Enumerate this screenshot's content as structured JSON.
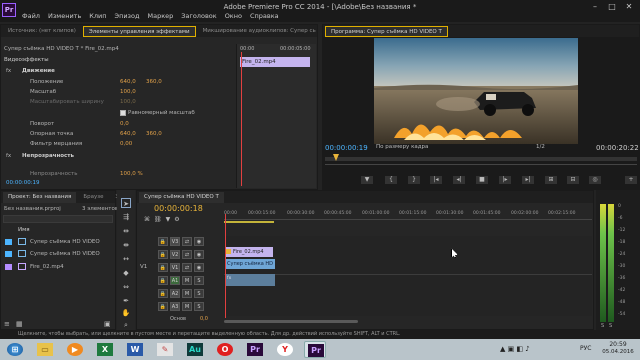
{
  "window": {
    "title": "Adobe Premiere Pro CC 2014 - [\\Adobe\\Без названия *",
    "menu": [
      "Файл",
      "Изменить",
      "Клип",
      "Эпизод",
      "Маркер",
      "Заголовок",
      "Окно",
      "Справка"
    ]
  },
  "effects_panel": {
    "tabs": [
      "Источник: (нет клипов)",
      "Элементы управления эффектами",
      "Микширование аудиоклипов: Супер сь"
    ],
    "breadcrumb": "Супер съёмка HD VIDEO T * Fire_02.mp4",
    "section_video": "Видеоэффекты",
    "motion_label": "Движение",
    "rows": [
      {
        "label": "Положение",
        "v1": "640,0",
        "v2": "360,0"
      },
      {
        "label": "Масштаб",
        "v1": "100,0",
        "v2": ""
      },
      {
        "label": "Масштабировать ширину",
        "v1": "100,0",
        "v2": ""
      },
      {
        "label": "Поворот",
        "v1": "0,0",
        "v2": ""
      },
      {
        "label": "Опорная точка",
        "v1": "640,0",
        "v2": "360,0"
      },
      {
        "label": "Фильтр мерцания",
        "v1": "0,00",
        "v2": ""
      }
    ],
    "uniform_scale": "Равномерный масштаб",
    "opacity_label": "Непрозрачность",
    "opacity_sub": "Непрозрачность",
    "opacity_value": "100,0 %",
    "clip_name": "Fire_02.mp4",
    "timecode": "00:00:00:19",
    "ruler_left": "00:00",
    "ruler_right": "00:00:05:00"
  },
  "program": {
    "tab": "Программа: Супер съёмка HD VIDEO T",
    "timecode_left": "00:00:00:19",
    "fit_label": "По размеру кадра",
    "ratio": "1/2",
    "timecode_right": "00:00:20:22"
  },
  "project": {
    "tabs": [
      "Проект: Без названия",
      "Браузе",
      "Эфф"
    ],
    "file": "Без названия.prproj",
    "count": "3 элементов",
    "column_name": "Имя",
    "items": [
      {
        "name": "Супер съёмка HD VIDEO",
        "color": "#4db5ff"
      },
      {
        "name": "Супер съёмка HD VIDEO",
        "color": "#4db5ff"
      },
      {
        "name": "Fire_02.mp4",
        "color": "#b48cff"
      }
    ]
  },
  "timeline": {
    "tab": "Супер съёмка HD VIDEO T",
    "timecode": "00:00:00:18",
    "ruler": [
      "00:00",
      "00:00:15:00",
      "00:00:30:00",
      "00:00:45:00",
      "00:01:00:00",
      "00:01:15:00",
      "00:01:30:00",
      "00:01:45:00",
      "00:02:00:00",
      "00:02:15:00"
    ],
    "video_tracks": [
      "V3",
      "V2",
      "V1"
    ],
    "audio_tracks": [
      "A1",
      "A2",
      "A3"
    ],
    "source_v1": "V1",
    "master": "Основ",
    "master_value": "0,0",
    "clip_fire": "Fire_02.mp4",
    "clip_super": "Супер съёмка HD",
    "clip_audio": "fx"
  },
  "meters": {
    "scale": [
      "0",
      "-6",
      "-12",
      "-18",
      "-24",
      "-30",
      "-36",
      "-42",
      "-48",
      "-54"
    ],
    "footer": [
      "S",
      "S"
    ]
  },
  "status": {
    "text": "Щелкните, чтобы выбрать, или щелкните в пустом месте и перетащите выделенную область. Для др. действий используйте SHIFT, ALT и CTRL."
  },
  "taskbar": {
    "lang": "РУС",
    "time": "20:59",
    "date": "05.04.2016"
  }
}
